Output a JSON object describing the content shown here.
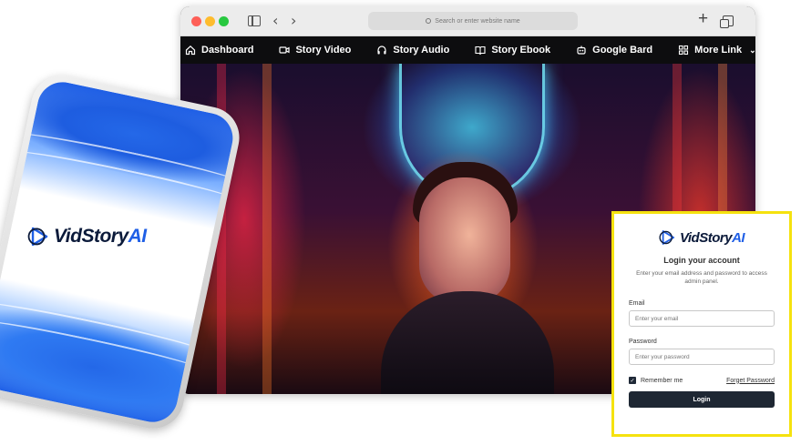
{
  "browser": {
    "address_placeholder": "Search or enter website name"
  },
  "navbar": {
    "items": [
      {
        "label": "Dashboard",
        "icon": "home-icon"
      },
      {
        "label": "Story Video",
        "icon": "video-icon"
      },
      {
        "label": "Story Audio",
        "icon": "headphones-icon"
      },
      {
        "label": "Story Ebook",
        "icon": "book-icon"
      },
      {
        "label": "Google Bard",
        "icon": "bot-icon"
      },
      {
        "label": "More Link",
        "icon": "grid-icon"
      }
    ]
  },
  "phone": {
    "brand": "VidStory",
    "brand_suffix": "AI"
  },
  "login": {
    "brand": "VidStory",
    "brand_suffix": "AI",
    "title": "Login your account",
    "subtitle": "Enter your email address and password to access admin panel.",
    "email_label": "Email",
    "email_placeholder": "Enter your email",
    "password_label": "Password",
    "password_placeholder": "Enter your password",
    "remember_label": "Remember me",
    "forgot_label": "Forget Password",
    "button_label": "Login",
    "highlight_color": "#f5e20f"
  }
}
